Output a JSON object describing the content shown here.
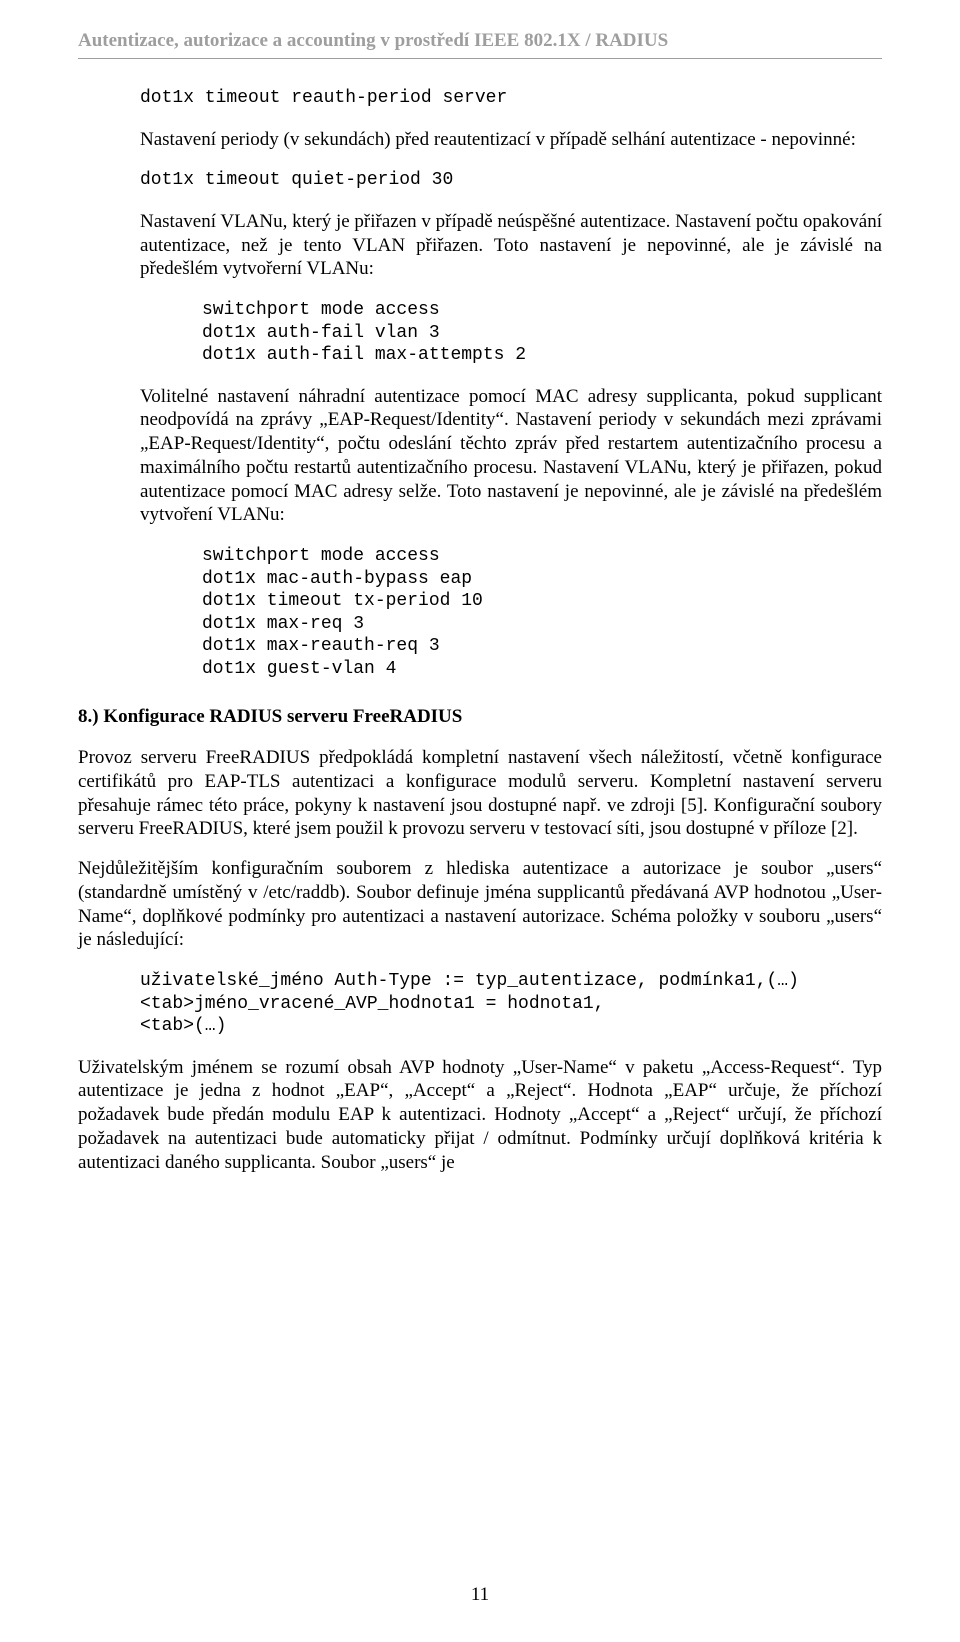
{
  "header": "Autentizace, autorizace a accounting v prostředí IEEE 802.1X / RADIUS",
  "code1": "dot1x timeout reauth-period server",
  "para1": "Nastavení periody (v sekundách) před reautentizací v případě selhání autentizace - nepovinné:",
  "code2": "dot1x timeout quiet-period 30",
  "para2": "Nastavení VLANu, který je přiřazen v případě neúspěšné autentizace. Nastavení počtu opakování autentizace, než je tento VLAN přiřazen. Toto nastavení je nepovinné, ale je závislé na předešlém vytvořerní VLANu:",
  "code3": "switchport mode access\ndot1x auth-fail vlan 3\ndot1x auth-fail max-attempts 2",
  "para3": "Volitelné nastavení náhradní autentizace pomocí MAC adresy supplicanta, pokud supplicant neodpovídá na zprávy „EAP-Request/Identity“. Nastavení periody v sekundách mezi zprávami „EAP-Request/Identity“, počtu odeslání těchto zpráv před restartem autentizačního procesu a maximálního počtu restartů autentizačního procesu. Nastavení VLANu, který je přiřazen, pokud autentizace pomocí MAC adresy selže. Toto nastavení je nepovinné, ale je závislé na předešlém vytvoření VLANu:",
  "code4": "switchport mode access\ndot1x mac-auth-bypass eap\ndot1x timeout tx-period 10\ndot1x max-req 3\ndot1x max-reauth-req 3\ndot1x guest-vlan 4",
  "section_heading": "8.) Konfigurace RADIUS serveru FreeRADIUS",
  "para4": "Provoz serveru FreeRADIUS předpokládá kompletní nastavení všech náležitostí, včetně konfigurace certifikátů pro EAP-TLS autentizaci a konfigurace modulů serveru. Kompletní nastavení serveru přesahuje rámec této práce, pokyny k nastavení jsou dostupné např. ve zdroji [5]. Konfigurační soubory serveru FreeRADIUS, které jsem použil k provozu serveru v testovací síti, jsou dostupné v příloze [2].",
  "para5": "Nejdůležitějším konfiguračním souborem z hlediska autentizace a autorizace je soubor „users“ (standardně umístěný v /etc/raddb). Soubor definuje jména supplicantů předávaná AVP hodnotou „User-Name“, doplňkové podmínky pro autentizaci a nastavení autorizace. Schéma položky v souboru „users“ je následující:",
  "code5": "uživatelské_jméno Auth-Type := typ_autentizace, podmínka1,(…)\n<tab>jméno_vracené_AVP_hodnota1 = hodnota1,\n<tab>(…)",
  "para6": "Uživatelským jménem se rozumí obsah AVP hodnoty „User-Name“ v paketu „Access-Request“. Typ autentizace je jedna z hodnot „EAP“, „Accept“ a „Reject“. Hodnota „EAP“ určuje, že příchozí požadavek bude předán modulu EAP k autentizaci. Hodnoty „Accept“ a „Reject“ určují, že příchozí požadavek na autentizaci bude automaticky přijat / odmítnut. Podmínky určují doplňková kritéria k autentizaci daného supplicanta. Soubor „users“ je",
  "page_number": "11"
}
